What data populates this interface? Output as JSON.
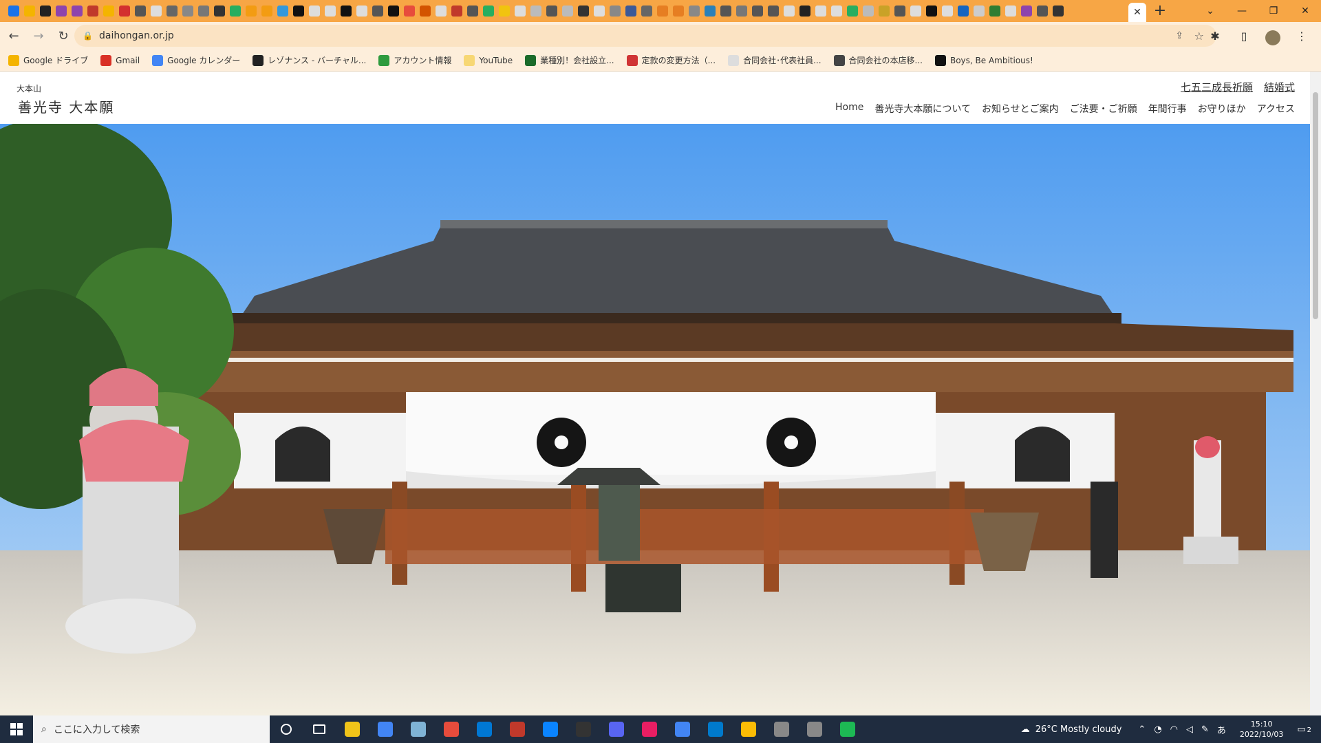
{
  "browser": {
    "url": "daihongan.or.jp",
    "active_tab_close": "✕",
    "new_tab": "+"
  },
  "bookmarks": [
    {
      "label": "Google ドライブ",
      "color": "#f4b400"
    },
    {
      "label": "Gmail",
      "color": "#d93025"
    },
    {
      "label": "Google カレンダー",
      "color": "#4285f4"
    },
    {
      "label": "レゾナンス - バーチャル...",
      "color": "#222222"
    },
    {
      "label": "アカウント情報",
      "color": "#2e9b3e"
    },
    {
      "label": "YouTube",
      "color": "#f7d774"
    },
    {
      "label": "業種別！会社設立...",
      "color": "#1b6b2a"
    },
    {
      "label": "定款の変更方法（...",
      "color": "#d03434"
    },
    {
      "label": "合同会社･代表社員...",
      "color": "#dddddd"
    },
    {
      "label": "合同会社の本店移...",
      "color": "#444444"
    },
    {
      "label": "Boys, Be Ambitious!",
      "color": "#111111"
    }
  ],
  "site": {
    "logo_small": "大本山",
    "logo_main": "善光寺 大本願",
    "top_links": [
      "七五三成長祈願",
      "結婚式"
    ],
    "nav": [
      "Home",
      "善光寺大本願について",
      "お知らせとご案内",
      "ご法要・ご祈願",
      "年間行事",
      "お守りほか",
      "アクセス"
    ]
  },
  "taskbar": {
    "search_placeholder": "ここに入力して検索",
    "weather": "26°C  Mostly cloudy",
    "time": "15:10",
    "date": "2022/10/03",
    "notifications": "2"
  }
}
